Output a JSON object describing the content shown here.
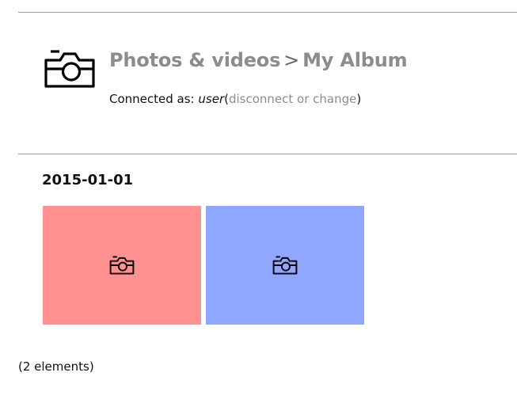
{
  "header": {
    "icon": "camera-icon",
    "breadcrumb": {
      "root_label": "Photos & videos",
      "separator": ">",
      "current_label": "My Album"
    },
    "connection": {
      "prefix": "Connected as:",
      "user": "user",
      "open_paren": "(",
      "change_link": "disconnect or change",
      "close_paren": ")"
    }
  },
  "album": {
    "groups": [
      {
        "date": "2015-01-01",
        "items": [
          {
            "icon": "camera-icon",
            "color": "#ff9191"
          },
          {
            "icon": "camera-icon",
            "color": "#91a7ff"
          }
        ]
      }
    ],
    "count_text": "(2 elements)"
  },
  "colors": {
    "link": "#8c8c8c",
    "rule": "#9a9a9a"
  }
}
